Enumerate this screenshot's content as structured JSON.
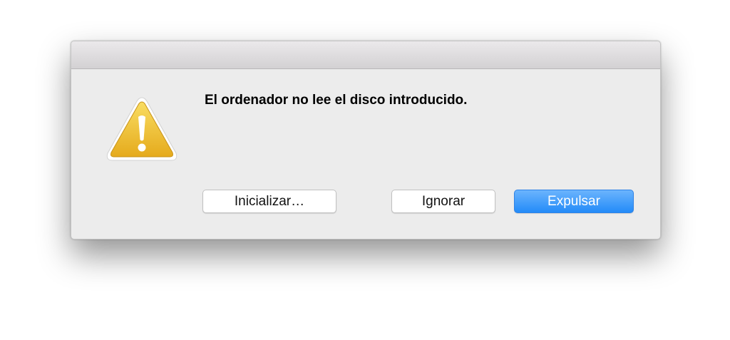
{
  "dialog": {
    "message": "El ordenador no lee el disco introducido.",
    "icon": "warning-triangle-icon",
    "buttons": {
      "initialize": "Inicializar…",
      "ignore": "Ignorar",
      "eject": "Expulsar"
    }
  },
  "colors": {
    "accent": "#238bf8",
    "warning": "#f2c435",
    "background": "#ececec"
  }
}
